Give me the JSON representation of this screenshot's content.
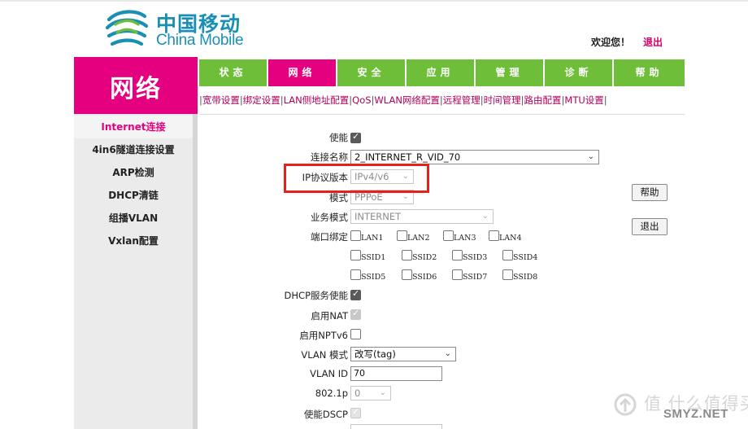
{
  "header": {
    "logo_cn": "中国移动",
    "logo_en": "China Mobile",
    "welcome": "欢迎您！",
    "logout": "退出"
  },
  "section_title": "网络",
  "tabs": [
    {
      "label": "状态"
    },
    {
      "label": "网络",
      "active": true
    },
    {
      "label": "安全"
    },
    {
      "label": "应用"
    },
    {
      "label": "管理"
    },
    {
      "label": "诊断"
    },
    {
      "label": "帮助"
    }
  ],
  "subnav": [
    "宽带设置",
    "绑定设置",
    "LAN侧地址配置",
    "QoS",
    "WLAN网络配置",
    "远程管理",
    "时间管理",
    "路由配置",
    "MTU设置"
  ],
  "sidebar": {
    "items": [
      {
        "label": "Internet连接",
        "active": true
      },
      {
        "label": "4in6隧道连接设置"
      },
      {
        "label": "ARP检测"
      },
      {
        "label": "DHCP清链"
      },
      {
        "label": "组播VLAN"
      },
      {
        "label": "Vxlan配置"
      }
    ]
  },
  "form": {
    "enable_label": "使能",
    "connection_name_label": "连接名称",
    "connection_name_value": "2_INTERNET_R_VID_70",
    "ip_version_label": "IP协议版本",
    "ip_version_value": "IPv4/v6",
    "mode_label": "模式",
    "mode_value": "PPPoE",
    "service_mode_label": "业务模式",
    "service_mode_value": "INTERNET",
    "port_binding_label": "端口绑定",
    "ports": [
      "LAN1",
      "LAN2",
      "LAN3",
      "LAN4",
      "SSID1",
      "SSID2",
      "SSID3",
      "SSID4",
      "SSID5",
      "SSID6",
      "SSID7",
      "SSID8"
    ],
    "dhcp_label": "DHCP服务使能",
    "nat_label": "启用NAT",
    "nptv6_label": "启用NPTv6",
    "vlan_mode_label": "VLAN 模式",
    "vlan_mode_value": "改写(tag)",
    "vlan_id_label": "VLAN ID",
    "vlan_id_value": "70",
    "dot1p_label": "802.1p",
    "dot1p_value": "0",
    "dscp_label": "使能DSCP"
  },
  "buttons": {
    "help": "帮助",
    "exit": "退出"
  },
  "watermark": {
    "cn": "值 什么值得买",
    "en": "SMYZ.NET"
  },
  "colors": {
    "brand_magenta": "#e4007f",
    "tab_green": "#6fbe39",
    "logo_blue": "#1a8fb5",
    "highlight_red": "#e8201a"
  }
}
